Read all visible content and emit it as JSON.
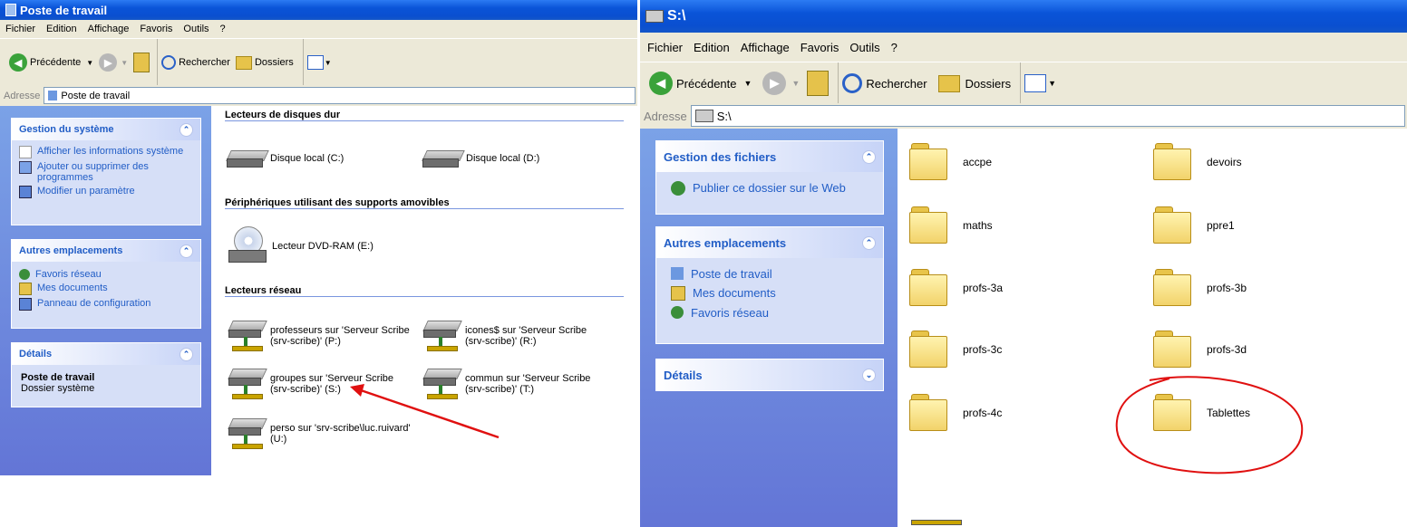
{
  "left": {
    "title": "Poste de travail",
    "menu": [
      "Fichier",
      "Edition",
      "Affichage",
      "Favoris",
      "Outils",
      "?"
    ],
    "toolbar": {
      "back": "Précédente",
      "search": "Rechercher",
      "folders": "Dossiers"
    },
    "address_label": "Adresse",
    "address_value": "Poste de travail",
    "panels": {
      "system": {
        "title": "Gestion du système",
        "links": [
          "Afficher les informations système",
          "Ajouter ou supprimer des programmes",
          "Modifier un paramètre"
        ]
      },
      "places": {
        "title": "Autres emplacements",
        "links": [
          "Favoris réseau",
          "Mes documents",
          "Panneau de configuration"
        ]
      },
      "details": {
        "title": "Détails",
        "name": "Poste de travail",
        "type": "Dossier système"
      }
    },
    "groups": {
      "hdd": "Lecteurs de disques dur",
      "removable": "Périphériques utilisant des supports amovibles",
      "network": "Lecteurs réseau"
    },
    "drives": {
      "c": "Disque local (C:)",
      "d": "Disque local (D:)",
      "e": "Lecteur DVD-RAM (E:)",
      "p1": "professeurs sur 'Serveur Scribe",
      "p2": "(srv-scribe)' (P:)",
      "r1": "icones$ sur 'Serveur Scribe",
      "r2": "(srv-scribe)' (R:)",
      "s1": "groupes sur 'Serveur Scribe",
      "s2": "(srv-scribe)' (S:)",
      "t1": "commun sur 'Serveur Scribe",
      "t2": "(srv-scribe)' (T:)",
      "u1": "perso sur 'srv-scribe\\luc.ruivard'",
      "u2": "(U:)"
    }
  },
  "right": {
    "title": "S:\\",
    "menu": [
      "Fichier",
      "Edition",
      "Affichage",
      "Favoris",
      "Outils",
      "?"
    ],
    "toolbar": {
      "back": "Précédente",
      "search": "Rechercher",
      "folders": "Dossiers"
    },
    "address_label": "Adresse",
    "address_value": "S:\\",
    "panels": {
      "files": {
        "title": "Gestion des fichiers",
        "links": [
          "Publier ce dossier sur le Web"
        ]
      },
      "places": {
        "title": "Autres emplacements",
        "links": [
          "Poste de travail",
          "Mes documents",
          "Favoris réseau"
        ]
      },
      "details": {
        "title": "Détails"
      }
    },
    "folders": [
      "accpe",
      "devoirs",
      "maths",
      "ppre1",
      "profs-3a",
      "profs-3b",
      "profs-3c",
      "profs-3d",
      "profs-4c",
      "Tablettes"
    ]
  },
  "colors": {
    "annotation": "#e01010",
    "link": "#215dc6",
    "titlebar": "#0a54d8"
  }
}
